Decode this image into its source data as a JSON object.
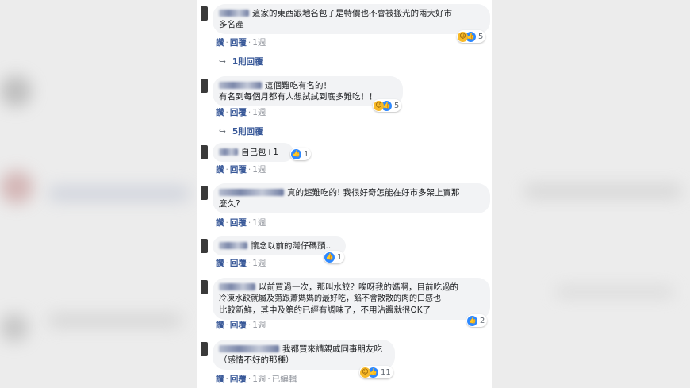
{
  "comments": [
    {
      "text_lines": [
        "這家的東西跟地名包子是特價也不會被搬光的兩大好市",
        "多名產"
      ],
      "actions": {
        "like": "讚",
        "reply": "回覆",
        "time": "1週"
      },
      "reactions": {
        "icons": [
          "haha",
          "like"
        ],
        "count": "5"
      },
      "replies_label": "1則回覆"
    },
    {
      "text_lines": [
        "這個難吃有名的！",
        "有名到每個月都有人想試試到底多難吃！！"
      ],
      "actions": {
        "like": "讚",
        "reply": "回覆",
        "time": "1週"
      },
      "reactions": {
        "icons": [
          "haha",
          "like"
        ],
        "count": "5"
      },
      "replies_label": "5則回覆"
    },
    {
      "text_lines": [
        "自己包+1"
      ],
      "actions": {
        "like": "讚",
        "reply": "回覆",
        "time": "1週"
      },
      "reactions": {
        "icons": [
          "like"
        ],
        "count": "1"
      }
    },
    {
      "text_lines": [
        "真的超難吃的! 我很好奇怎能在好市多架上賣那",
        "麼久?"
      ],
      "actions": {
        "like": "讚",
        "reply": "回覆",
        "time": "1週"
      }
    },
    {
      "text_lines": [
        "懷念以前的灣仔碼頭.."
      ],
      "actions": {
        "like": "讚",
        "reply": "回覆",
        "time": "1週"
      },
      "reactions": {
        "icons": [
          "like"
        ],
        "count": "1"
      }
    },
    {
      "text_lines": [
        "以前買過一次，那叫水餃？唉呀我的媽啊，目前吃過的",
        "冷凍水餃就屬及第跟蕭媽媽的最好吃，餡不會散散的肉的口感也",
        "比較新鮮，其中及第的已經有調味了，不用沾醬就很OK了"
      ],
      "actions": {
        "like": "讚",
        "reply": "回覆",
        "time": "1週"
      },
      "reactions": {
        "icons": [
          "like"
        ],
        "count": "2"
      }
    },
    {
      "text_lines": [
        "我都買來請親戚同事朋友吃",
        "（感情不好的那種）"
      ],
      "actions": {
        "like": "讚",
        "reply": "回覆",
        "time": "1週",
        "edited": "已編輯"
      },
      "reactions": {
        "icons": [
          "haha",
          "like"
        ],
        "count": "11"
      }
    }
  ],
  "colors": {
    "link": "#385898",
    "bubble": "#f2f3f5",
    "like": "#2d88ff",
    "haha": "#f7b928"
  }
}
